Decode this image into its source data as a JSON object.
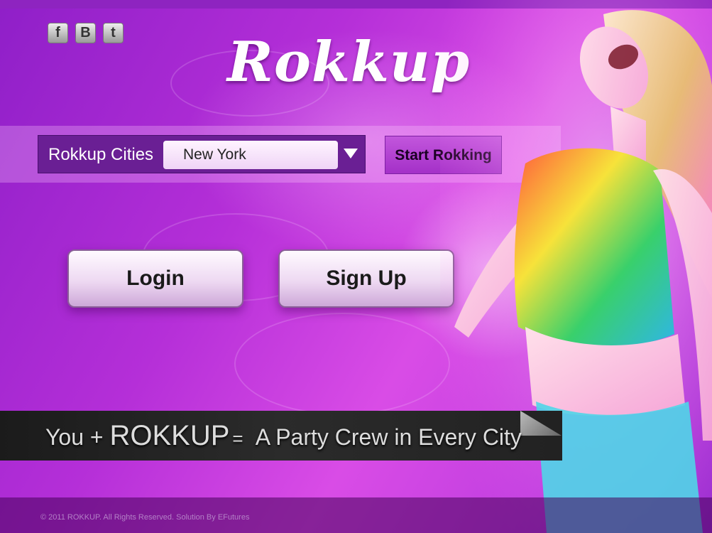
{
  "brand": {
    "logo_text": "Rokkup"
  },
  "social": [
    {
      "name": "facebook",
      "glyph": "f"
    },
    {
      "name": "blogger",
      "glyph": "B"
    },
    {
      "name": "twitter",
      "glyph": "t"
    }
  ],
  "city_picker": {
    "label": "Rokkup Cities",
    "selected": "New York",
    "start_label": "Start Rokking"
  },
  "actions": {
    "login_label": "Login",
    "signup_label": "Sign Up"
  },
  "tagline": {
    "prefix": "You +",
    "brand": "ROKKUP",
    "equals": "=",
    "suffix": "A Party Crew in Every City"
  },
  "footer": {
    "copyright": "© 2011 ROKKUP. All Rights Reserved. Solution By EFutures"
  },
  "colors": {
    "primary": "#b52fd8",
    "dark_panel": "#6a1f94",
    "tagline_bg": "#222222"
  }
}
